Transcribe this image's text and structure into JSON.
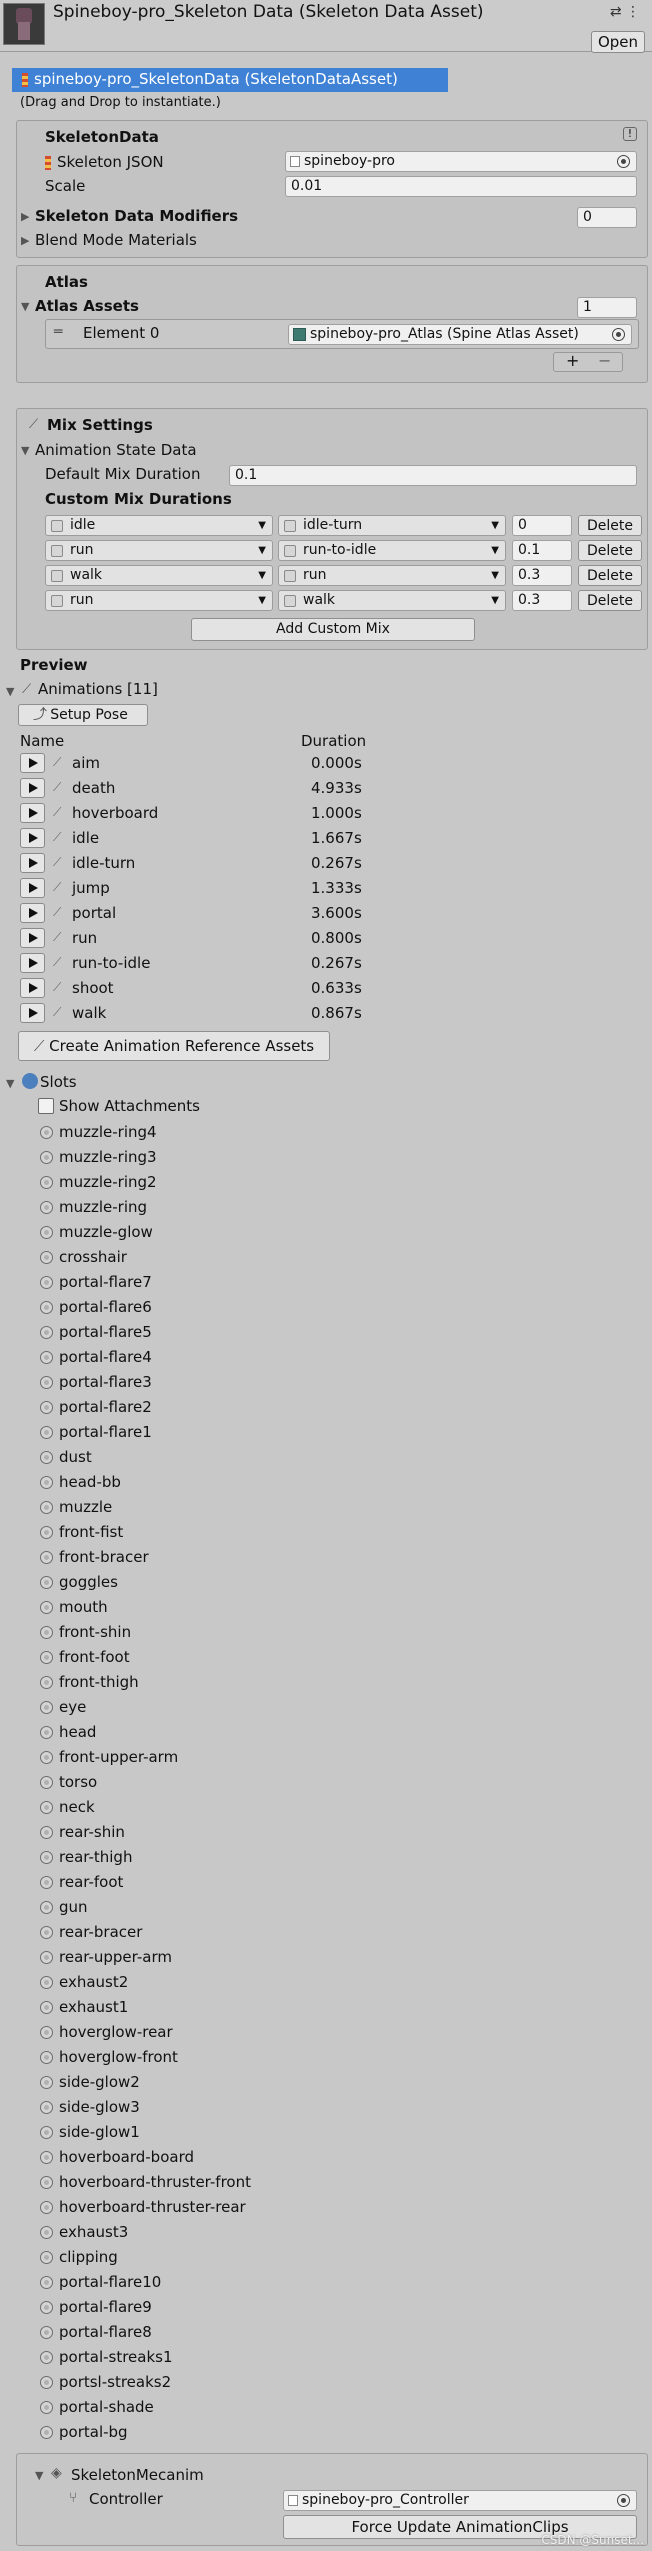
{
  "header": {
    "title": "Spineboy-pro_Skeleton Data (Skeleton Data Asset)",
    "open_label": "Open",
    "settings_icon": "sliders-icon",
    "menu_icon": "kebab-menu-icon"
  },
  "asset": {
    "selected_label": "spineboy-pro_SkeletonData (SkeletonDataAsset)",
    "hint": "(Drag and Drop to instantiate.)"
  },
  "skeleton_data": {
    "title": "SkeletonData",
    "info_icon": "!",
    "json_label": "Skeleton JSON",
    "json_value": "spineboy-pro",
    "scale_label": "Scale",
    "scale_value": "0.01",
    "modifiers_label": "Skeleton Data Modifiers",
    "modifiers_count": "0",
    "blend_label": "Blend Mode Materials"
  },
  "atlas": {
    "title": "Atlas",
    "assets_label": "Atlas Assets",
    "assets_count": "1",
    "element_label": "Element 0",
    "element_value": "spineboy-pro_Atlas (Spine Atlas Asset)",
    "add_symbol": "+",
    "remove_symbol": "−"
  },
  "mix": {
    "title": "Mix Settings",
    "state_label": "Animation State Data",
    "default_label": "Default Mix Duration",
    "default_value": "0.1",
    "custom_label": "Custom Mix Durations",
    "rows": [
      {
        "from": "idle",
        "to": "idle-turn",
        "duration": "0",
        "delete": "Delete"
      },
      {
        "from": "run",
        "to": "run-to-idle",
        "duration": "0.1",
        "delete": "Delete"
      },
      {
        "from": "walk",
        "to": "run",
        "duration": "0.3",
        "delete": "Delete"
      },
      {
        "from": "run",
        "to": "walk",
        "duration": "0.3",
        "delete": "Delete"
      }
    ],
    "add_label": "Add Custom Mix"
  },
  "preview": {
    "title": "Preview",
    "animations_label": "Animations [11]",
    "setup_pose_label": "Setup Pose",
    "col_name": "Name",
    "col_duration": "Duration",
    "animations": [
      {
        "name": "aim",
        "duration": "0.000s"
      },
      {
        "name": "death",
        "duration": "4.933s"
      },
      {
        "name": "hoverboard",
        "duration": "1.000s"
      },
      {
        "name": "idle",
        "duration": "1.667s"
      },
      {
        "name": "idle-turn",
        "duration": "0.267s"
      },
      {
        "name": "jump",
        "duration": "1.333s"
      },
      {
        "name": "portal",
        "duration": "3.600s"
      },
      {
        "name": "run",
        "duration": "0.800s"
      },
      {
        "name": "run-to-idle",
        "duration": "0.267s"
      },
      {
        "name": "shoot",
        "duration": "0.633s"
      },
      {
        "name": "walk",
        "duration": "0.867s"
      }
    ],
    "create_refs_label": "Create Animation Reference Assets"
  },
  "slots": {
    "title": "Slots",
    "show_attachments_label": "Show Attachments",
    "items": [
      "muzzle-ring4",
      "muzzle-ring3",
      "muzzle-ring2",
      "muzzle-ring",
      "muzzle-glow",
      "crosshair",
      "portal-flare7",
      "portal-flare6",
      "portal-flare5",
      "portal-flare4",
      "portal-flare3",
      "portal-flare2",
      "portal-flare1",
      "dust",
      "head-bb",
      "muzzle",
      "front-fist",
      "front-bracer",
      "goggles",
      "mouth",
      "front-shin",
      "front-foot",
      "front-thigh",
      "eye",
      "head",
      "front-upper-arm",
      "torso",
      "neck",
      "rear-shin",
      "rear-thigh",
      "rear-foot",
      "gun",
      "rear-bracer",
      "rear-upper-arm",
      "exhaust2",
      "exhaust1",
      "hoverglow-rear",
      "hoverglow-front",
      "side-glow2",
      "side-glow3",
      "side-glow1",
      "hoverboard-board",
      "hoverboard-thruster-front",
      "hoverboard-thruster-rear",
      "exhaust3",
      "clipping",
      "portal-flare10",
      "portal-flare9",
      "portal-flare8",
      "portal-streaks1",
      "portsl-streaks2",
      "portal-shade",
      "portal-bg"
    ]
  },
  "mecanim": {
    "title": "SkeletonMecanim",
    "controller_label": "Controller",
    "controller_value": "spineboy-pro_Controller",
    "force_update_label": "Force Update AnimationClips"
  },
  "watermark": "CSDN @Sunset..."
}
